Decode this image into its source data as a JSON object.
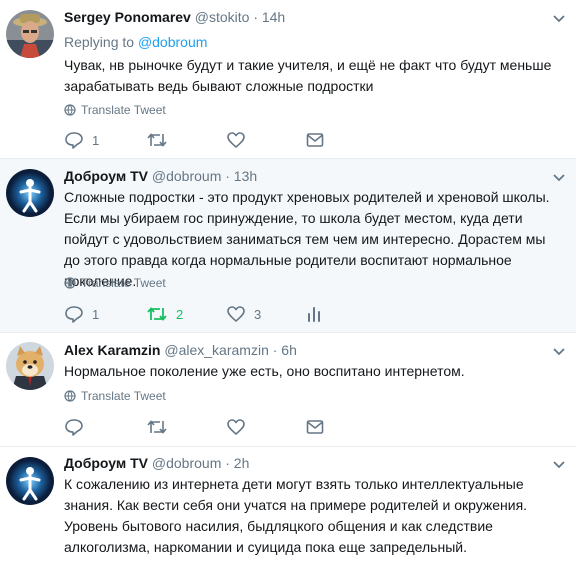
{
  "tweets": [
    {
      "name": "Sergey Ponomarev",
      "handle": "@stokito",
      "time": "· 14h",
      "reply_label": "Replying to",
      "reply_handle": "@dobroum",
      "text": "Чувак, нв рыночке будут и такие учителя, и ещё не факт что будут меньше зарабатывать ведь бывают сложные подростки",
      "translate": "Translate Tweet",
      "replies": "1",
      "retweets": "",
      "likes": ""
    },
    {
      "name": "Доброум TV",
      "handle": "@dobroum",
      "time": "· 13h",
      "text": "Сложные подростки - это продукт хреновых родителей и хреновой школы. Если мы убираем гос принуждение, то школа будет местом, куда дети пойдут с удовольствием заниматься тем чем им интересно. Дорастем мы до этого правда когда нормальные родители воспитают нормальное поколение.",
      "translate": "Translate Tweet",
      "replies": "1",
      "retweets": "2",
      "likes": "3"
    },
    {
      "name": "Alex Karamzin",
      "handle": "@alex_karamzin",
      "time": "· 6h",
      "text": "Нормальное поколение уже есть, оно воспитано интернетом.",
      "translate": "Translate Tweet",
      "replies": "",
      "retweets": "",
      "likes": ""
    },
    {
      "name": "Доброум TV",
      "handle": "@dobroum",
      "time": "· 2h",
      "text": "К сожалению из интернета дети могут взять только интеллектуальные знания. Как вести себя они учатся на примере родителей и окружения. Уровень бытового насилия, быдляцкого общения и как следствие алкоголизма, наркомании и суицида пока еще запредельный."
    }
  ],
  "colors": {
    "accent": "#1da1f2",
    "retweet_active": "#17bf63",
    "muted": "#657786",
    "divider": "#e6ecf0"
  },
  "icons": [
    "reply-icon",
    "retweet-icon",
    "like-icon",
    "message-icon",
    "analytics-icon",
    "globe-icon",
    "chevron-down-icon"
  ]
}
